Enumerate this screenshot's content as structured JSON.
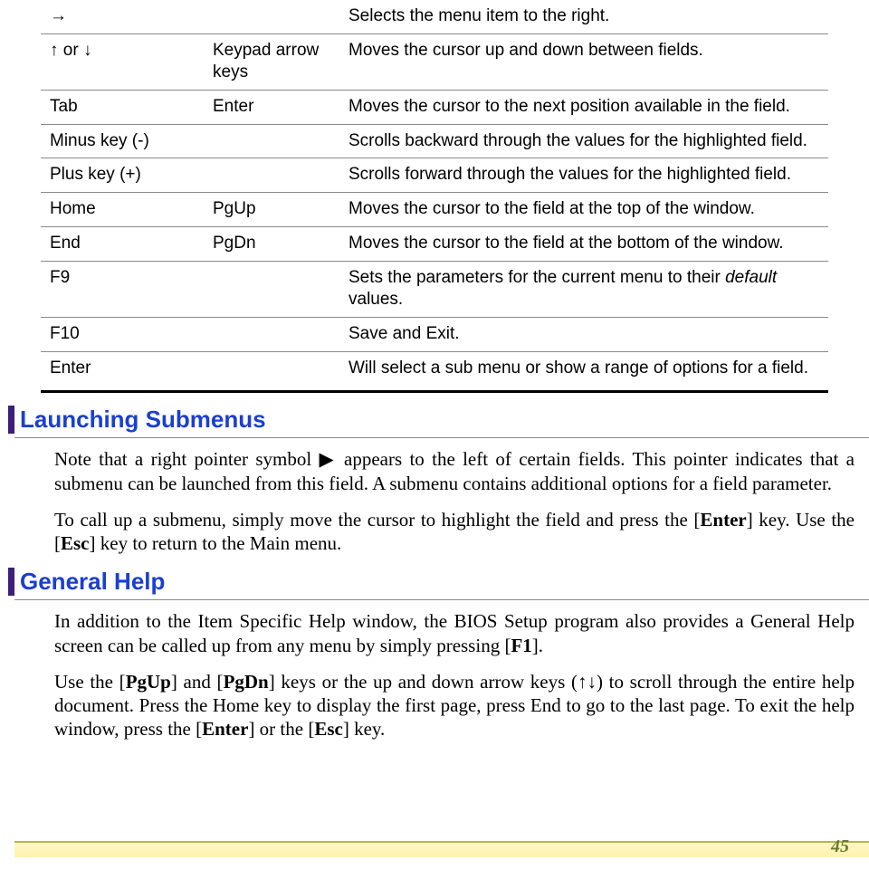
{
  "table": {
    "rows": [
      {
        "col1": "→",
        "col2": "",
        "col3": "Selects the menu item to the right."
      },
      {
        "col1": "↑ or ↓",
        "col2": "Keypad arrow keys",
        "col3": "Moves the cursor up and down between fields."
      },
      {
        "col1": "Tab",
        "col2": "Enter",
        "col3": "Moves the cursor to the next position available in the field."
      },
      {
        "col1": "Minus key (-)",
        "col2": "",
        "col3": "Scrolls backward through the values for the highlighted field."
      },
      {
        "col1": "Plus key (+)",
        "col2": "",
        "col3": "Scrolls forward through the values for the highlighted field."
      },
      {
        "col1": "Home",
        "col2": "PgUp",
        "col3": "Moves the cursor to the field at the top of the window."
      },
      {
        "col1": "End",
        "col2": "PgDn",
        "col3": "Moves the cursor to the field at the bottom of the window."
      },
      {
        "col1": "F9",
        "col2": "",
        "col3_pre": "Sets the parameters for the current menu to their ",
        "col3_italic": "default",
        "col3_post": " values."
      },
      {
        "col1": "F10",
        "col2": "",
        "col3": "Save and Exit."
      },
      {
        "col1": "Enter",
        "col2": "",
        "col3": "Will select a sub menu or show a range of options for a field."
      }
    ]
  },
  "sections": {
    "submenus": {
      "title": "Launching Submenus",
      "p1_pre": "Note that a right pointer symbol ",
      "p1_symbol": "▶",
      "p1_post": " appears to the left of certain fields.  This pointer indicates that a submenu can be launched from this field.  A submenu contains additional options for a field parameter.",
      "p2_a": "To call up a submenu, simply move the cursor to highlight the field and press the [",
      "p2_enter": "Enter",
      "p2_b": "] key.  Use the [",
      "p2_esc": "Esc",
      "p2_c": "] key to return to the Main menu."
    },
    "general": {
      "title": "General Help",
      "p1_a": "In addition to the Item Specific Help window, the BIOS Setup program also provides a General Help screen can be called up from any menu by simply pressing [",
      "p1_f1": "F1",
      "p1_b": "].",
      "p2_a": "Use the [",
      "p2_pgup": "PgUp",
      "p2_b": "] and [",
      "p2_pgdn": "PgDn",
      "p2_c": "] keys or the up and down arrow keys (↑↓) to scroll through the entire help document.   Press the Home key to display the first page, press End to go to the last page.  To exit the help window, press the [",
      "p2_enter": "Enter",
      "p2_d": "] or the [",
      "p2_esc": "Esc",
      "p2_e": "] key."
    }
  },
  "footer": {
    "page": "45"
  }
}
